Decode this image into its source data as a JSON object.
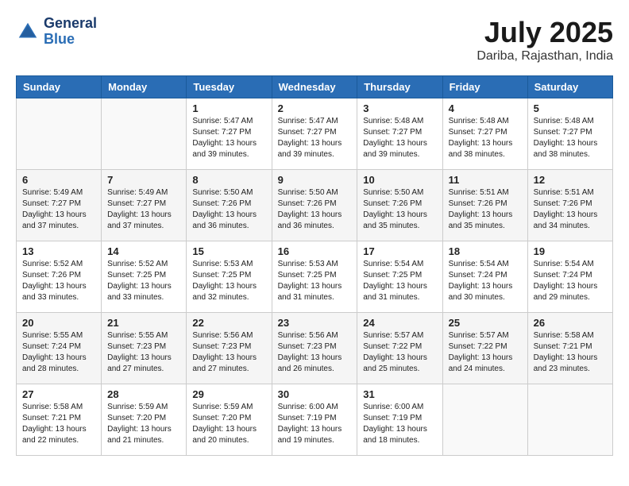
{
  "header": {
    "logo_general": "General",
    "logo_blue": "Blue",
    "month_year": "July 2025",
    "location": "Dariba, Rajasthan, India"
  },
  "weekdays": [
    "Sunday",
    "Monday",
    "Tuesday",
    "Wednesday",
    "Thursday",
    "Friday",
    "Saturday"
  ],
  "weeks": [
    [
      {
        "day": "",
        "info": ""
      },
      {
        "day": "",
        "info": ""
      },
      {
        "day": "1",
        "info": "Sunrise: 5:47 AM\nSunset: 7:27 PM\nDaylight: 13 hours and 39 minutes."
      },
      {
        "day": "2",
        "info": "Sunrise: 5:47 AM\nSunset: 7:27 PM\nDaylight: 13 hours and 39 minutes."
      },
      {
        "day": "3",
        "info": "Sunrise: 5:48 AM\nSunset: 7:27 PM\nDaylight: 13 hours and 39 minutes."
      },
      {
        "day": "4",
        "info": "Sunrise: 5:48 AM\nSunset: 7:27 PM\nDaylight: 13 hours and 38 minutes."
      },
      {
        "day": "5",
        "info": "Sunrise: 5:48 AM\nSunset: 7:27 PM\nDaylight: 13 hours and 38 minutes."
      }
    ],
    [
      {
        "day": "6",
        "info": "Sunrise: 5:49 AM\nSunset: 7:27 PM\nDaylight: 13 hours and 37 minutes."
      },
      {
        "day": "7",
        "info": "Sunrise: 5:49 AM\nSunset: 7:27 PM\nDaylight: 13 hours and 37 minutes."
      },
      {
        "day": "8",
        "info": "Sunrise: 5:50 AM\nSunset: 7:26 PM\nDaylight: 13 hours and 36 minutes."
      },
      {
        "day": "9",
        "info": "Sunrise: 5:50 AM\nSunset: 7:26 PM\nDaylight: 13 hours and 36 minutes."
      },
      {
        "day": "10",
        "info": "Sunrise: 5:50 AM\nSunset: 7:26 PM\nDaylight: 13 hours and 35 minutes."
      },
      {
        "day": "11",
        "info": "Sunrise: 5:51 AM\nSunset: 7:26 PM\nDaylight: 13 hours and 35 minutes."
      },
      {
        "day": "12",
        "info": "Sunrise: 5:51 AM\nSunset: 7:26 PM\nDaylight: 13 hours and 34 minutes."
      }
    ],
    [
      {
        "day": "13",
        "info": "Sunrise: 5:52 AM\nSunset: 7:26 PM\nDaylight: 13 hours and 33 minutes."
      },
      {
        "day": "14",
        "info": "Sunrise: 5:52 AM\nSunset: 7:25 PM\nDaylight: 13 hours and 33 minutes."
      },
      {
        "day": "15",
        "info": "Sunrise: 5:53 AM\nSunset: 7:25 PM\nDaylight: 13 hours and 32 minutes."
      },
      {
        "day": "16",
        "info": "Sunrise: 5:53 AM\nSunset: 7:25 PM\nDaylight: 13 hours and 31 minutes."
      },
      {
        "day": "17",
        "info": "Sunrise: 5:54 AM\nSunset: 7:25 PM\nDaylight: 13 hours and 31 minutes."
      },
      {
        "day": "18",
        "info": "Sunrise: 5:54 AM\nSunset: 7:24 PM\nDaylight: 13 hours and 30 minutes."
      },
      {
        "day": "19",
        "info": "Sunrise: 5:54 AM\nSunset: 7:24 PM\nDaylight: 13 hours and 29 minutes."
      }
    ],
    [
      {
        "day": "20",
        "info": "Sunrise: 5:55 AM\nSunset: 7:24 PM\nDaylight: 13 hours and 28 minutes."
      },
      {
        "day": "21",
        "info": "Sunrise: 5:55 AM\nSunset: 7:23 PM\nDaylight: 13 hours and 27 minutes."
      },
      {
        "day": "22",
        "info": "Sunrise: 5:56 AM\nSunset: 7:23 PM\nDaylight: 13 hours and 27 minutes."
      },
      {
        "day": "23",
        "info": "Sunrise: 5:56 AM\nSunset: 7:23 PM\nDaylight: 13 hours and 26 minutes."
      },
      {
        "day": "24",
        "info": "Sunrise: 5:57 AM\nSunset: 7:22 PM\nDaylight: 13 hours and 25 minutes."
      },
      {
        "day": "25",
        "info": "Sunrise: 5:57 AM\nSunset: 7:22 PM\nDaylight: 13 hours and 24 minutes."
      },
      {
        "day": "26",
        "info": "Sunrise: 5:58 AM\nSunset: 7:21 PM\nDaylight: 13 hours and 23 minutes."
      }
    ],
    [
      {
        "day": "27",
        "info": "Sunrise: 5:58 AM\nSunset: 7:21 PM\nDaylight: 13 hours and 22 minutes."
      },
      {
        "day": "28",
        "info": "Sunrise: 5:59 AM\nSunset: 7:20 PM\nDaylight: 13 hours and 21 minutes."
      },
      {
        "day": "29",
        "info": "Sunrise: 5:59 AM\nSunset: 7:20 PM\nDaylight: 13 hours and 20 minutes."
      },
      {
        "day": "30",
        "info": "Sunrise: 6:00 AM\nSunset: 7:19 PM\nDaylight: 13 hours and 19 minutes."
      },
      {
        "day": "31",
        "info": "Sunrise: 6:00 AM\nSunset: 7:19 PM\nDaylight: 13 hours and 18 minutes."
      },
      {
        "day": "",
        "info": ""
      },
      {
        "day": "",
        "info": ""
      }
    ]
  ]
}
